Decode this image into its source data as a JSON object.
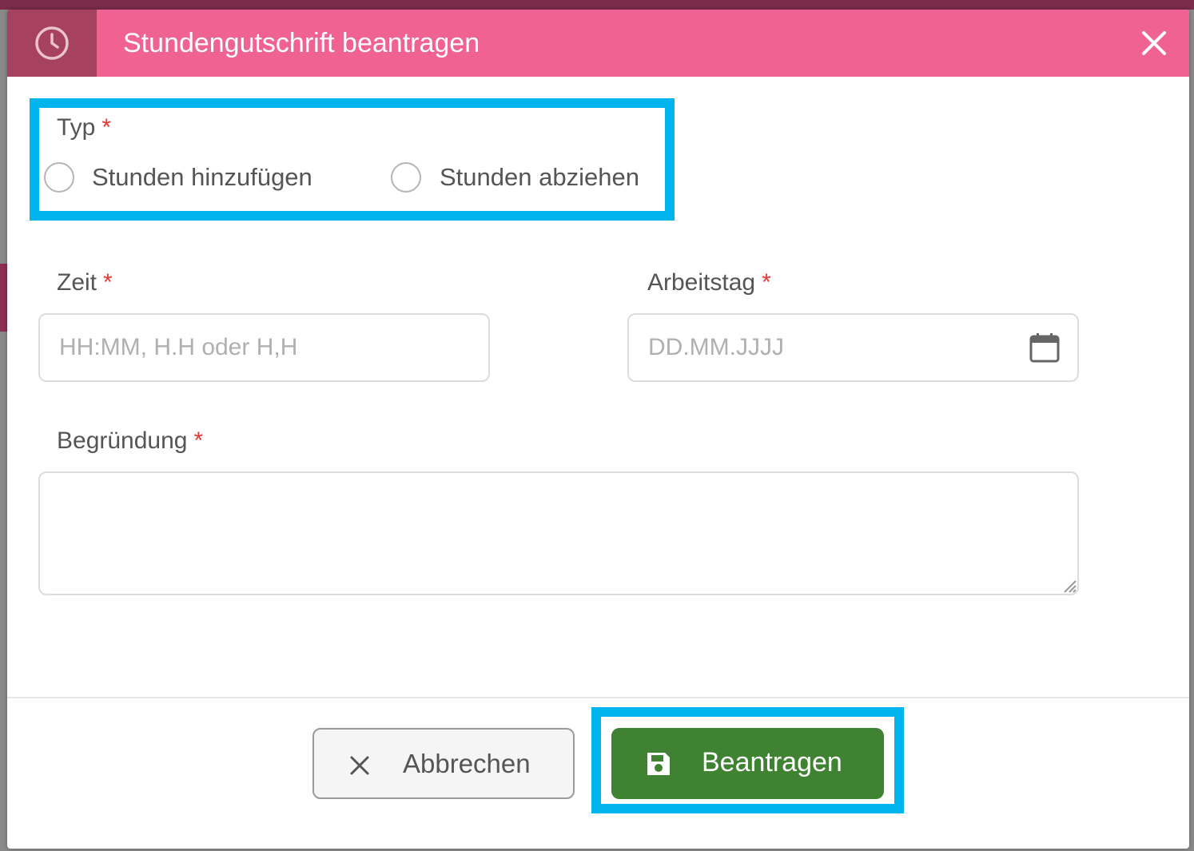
{
  "dialog": {
    "title": "Stundengutschrift beantragen",
    "header_icon": "clock-icon",
    "close_icon": "close-icon"
  },
  "form": {
    "type_label": "Typ",
    "required_mark": "*",
    "type_options": [
      {
        "label": "Stunden hinzufügen",
        "selected": false
      },
      {
        "label": "Stunden abziehen",
        "selected": false
      }
    ],
    "time_label": "Zeit",
    "time_placeholder": "HH:MM, H.H oder H,H",
    "time_value": "",
    "workday_label": "Arbeitstag",
    "workday_placeholder": "DD.MM.JJJJ",
    "workday_value": "",
    "workday_icon": "calendar-icon",
    "reason_label": "Begründung",
    "reason_value": ""
  },
  "footer": {
    "cancel_label": "Abbrechen",
    "cancel_icon": "x-icon",
    "submit_label": "Beantragen",
    "submit_icon": "save-icon"
  },
  "colors": {
    "header": "#f06292",
    "header_icon_box": "#a6415f",
    "required": "#e53935",
    "submit": "#3f8232",
    "highlight": "#00b4ee"
  }
}
